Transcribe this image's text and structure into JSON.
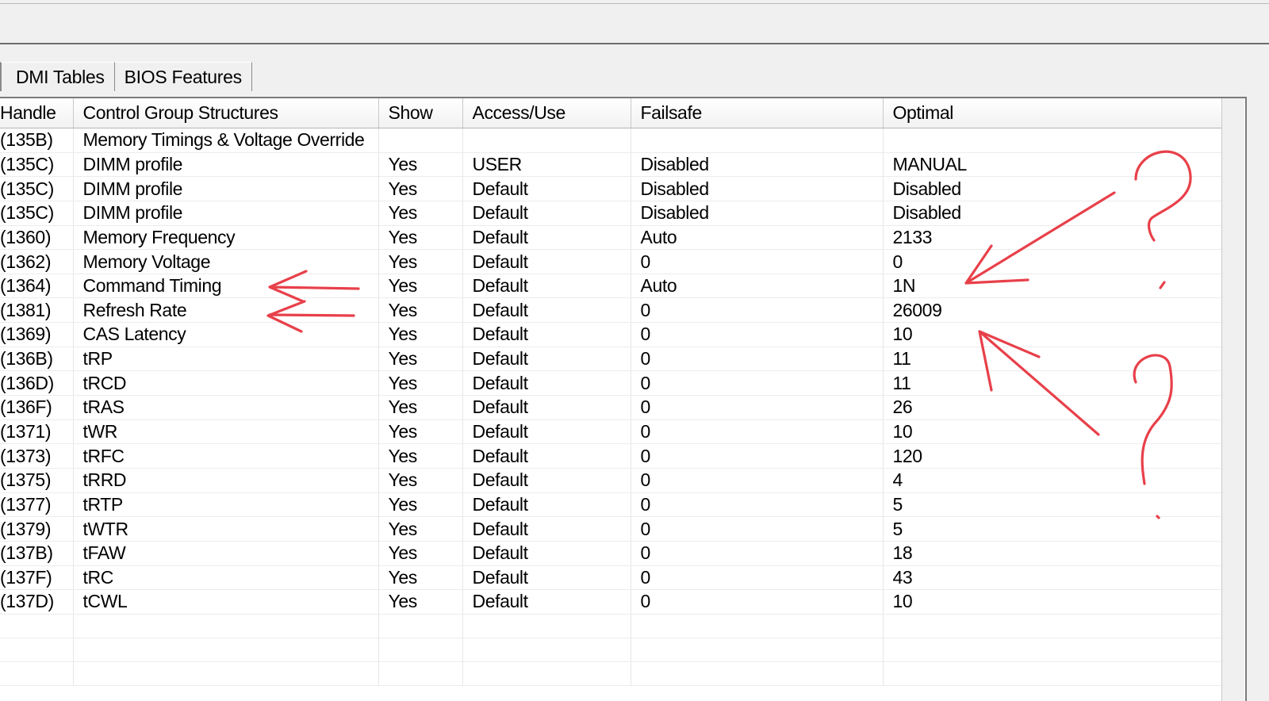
{
  "tabs": [
    {
      "label": "DMI Tables"
    },
    {
      "label": "BIOS Features"
    }
  ],
  "table": {
    "columns": [
      "Handle",
      "Control Group Structures",
      "Show",
      "Access/Use",
      "Failsafe",
      "Optimal"
    ],
    "rows": [
      [
        "(135B)",
        "Memory Timings & Voltage Override",
        "",
        "",
        "",
        ""
      ],
      [
        "(135C)",
        "DIMM profile",
        "Yes",
        "USER",
        "Disabled",
        "MANUAL"
      ],
      [
        "(135C)",
        "DIMM profile",
        "Yes",
        "Default",
        "Disabled",
        "Disabled"
      ],
      [
        "(135C)",
        "DIMM profile",
        "Yes",
        "Default",
        "Disabled",
        "Disabled"
      ],
      [
        "(1360)",
        "Memory Frequency",
        "Yes",
        "Default",
        "Auto",
        "2133"
      ],
      [
        "(1362)",
        "Memory Voltage",
        "Yes",
        "Default",
        "0",
        "0"
      ],
      [
        "(1364)",
        "Command Timing",
        "Yes",
        "Default",
        "Auto",
        "1N"
      ],
      [
        "(1381)",
        "Refresh Rate",
        "Yes",
        "Default",
        "0",
        "26009"
      ],
      [
        "(1369)",
        "CAS Latency",
        "Yes",
        "Default",
        "0",
        "10"
      ],
      [
        "(136B)",
        "tRP",
        "Yes",
        "Default",
        "0",
        "11"
      ],
      [
        "(136D)",
        "tRCD",
        "Yes",
        "Default",
        "0",
        "11"
      ],
      [
        "(136F)",
        "tRAS",
        "Yes",
        "Default",
        "0",
        "26"
      ],
      [
        "(1371)",
        "tWR",
        "Yes",
        "Default",
        "0",
        "10"
      ],
      [
        "(1373)",
        "tRFC",
        "Yes",
        "Default",
        "0",
        "120"
      ],
      [
        "(1375)",
        "tRRD",
        "Yes",
        "Default",
        "0",
        "4"
      ],
      [
        "(1377)",
        "tRTP",
        "Yes",
        "Default",
        "0",
        "5"
      ],
      [
        "(1379)",
        "tWTR",
        "Yes",
        "Default",
        "0",
        "5"
      ],
      [
        "(137B)",
        "tFAW",
        "Yes",
        "Default",
        "0",
        "18"
      ],
      [
        "(137F)",
        "tRC",
        "Yes",
        "Default",
        "0",
        "43"
      ],
      [
        "(137D)",
        "tCWL",
        "Yes",
        "Default",
        "0",
        "10"
      ]
    ],
    "empty_rows": 3
  },
  "colors": {
    "annotation": "#e8404a",
    "window_bg": "#f0f0f0",
    "grid_bg": "#ffffff"
  }
}
